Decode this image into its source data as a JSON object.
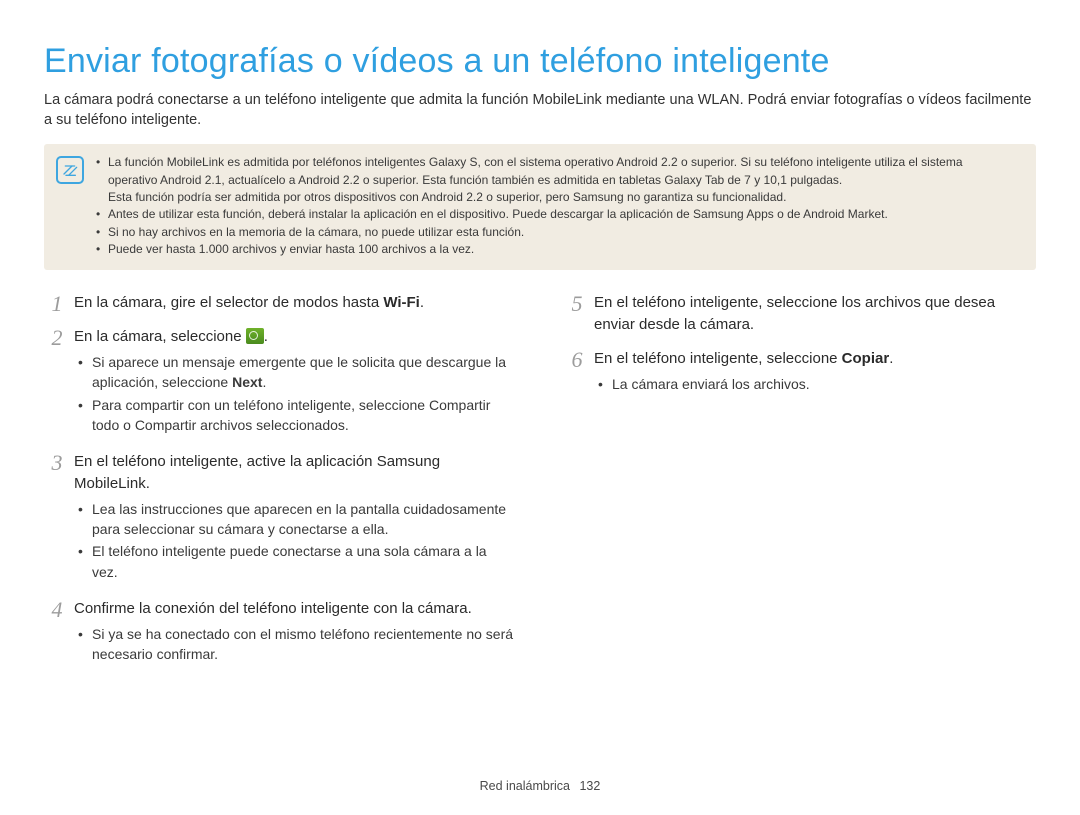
{
  "title": "Enviar fotografías o vídeos a un teléfono inteligente",
  "intro": "La cámara podrá conectarse a un teléfono inteligente que admita la función MobileLink mediante una WLAN. Podrá enviar fotografías o vídeos facilmente a su teléfono inteligente.",
  "note": {
    "items": [
      {
        "line1": "La función MobileLink es admitida por teléfonos inteligentes Galaxy S, con el sistema operativo Android 2.2 o superior. Si su teléfono inteligente utiliza el sistema",
        "line2": "operativo Android 2.1, actualícelo a Android 2.2 o superior. Esta función también es admitida en tabletas Galaxy Tab de 7 y 10,1 pulgadas.",
        "line3": "Esta función podría ser admitida por otros dispositivos con Android 2.2 o superior, pero Samsung no garantiza su funcionalidad."
      },
      {
        "line1": "Antes de utilizar esta función, deberá instalar la aplicación en el dispositivo. Puede descargar la aplicación de Samsung Apps o de Android Market."
      },
      {
        "line1": "Si no hay archivos en la memoria de la cámara, no puede utilizar esta función."
      },
      {
        "line1": "Puede ver hasta 1.000 archivos y enviar hasta 100 archivos a la vez."
      }
    ]
  },
  "steps": {
    "s1": {
      "num": "1",
      "pre": "En la cámara, gire el selector de modos hasta ",
      "wifi": "Wi-Fi",
      "post": "."
    },
    "s2": {
      "num": "2",
      "pre": "En la cámara, seleccione ",
      "post": ".",
      "sub1_pre": "Si aparece un mensaje emergente que le solicita que descargue la aplicación, seleccione ",
      "sub1_bold": "Next",
      "sub1_post": ".",
      "sub2": "Para compartir con un teléfono inteligente, seleccione Compartir todo o Compartir archivos seleccionados."
    },
    "s3": {
      "num": "3",
      "main": "En el teléfono inteligente, active la aplicación Samsung MobileLink.",
      "sub1": "Lea las instrucciones que aparecen en la pantalla cuidadosamente para seleccionar su cámara y conectarse a ella.",
      "sub2": "El teléfono inteligente puede conectarse a una sola cámara a la vez."
    },
    "s4": {
      "num": "4",
      "main": "Confirme la conexión del teléfono inteligente con la cámara.",
      "sub1": "Si ya se ha conectado con el mismo teléfono recientemente no será necesario confirmar."
    },
    "s5": {
      "num": "5",
      "main": "En el teléfono inteligente, seleccione los archivos que desea enviar desde la cámara."
    },
    "s6": {
      "num": "6",
      "pre": "En el teléfono inteligente, seleccione ",
      "bold": "Copiar",
      "post": ".",
      "sub1": "La cámara enviará los archivos."
    }
  },
  "footer": {
    "section": "Red inalámbrica",
    "page": "132"
  }
}
